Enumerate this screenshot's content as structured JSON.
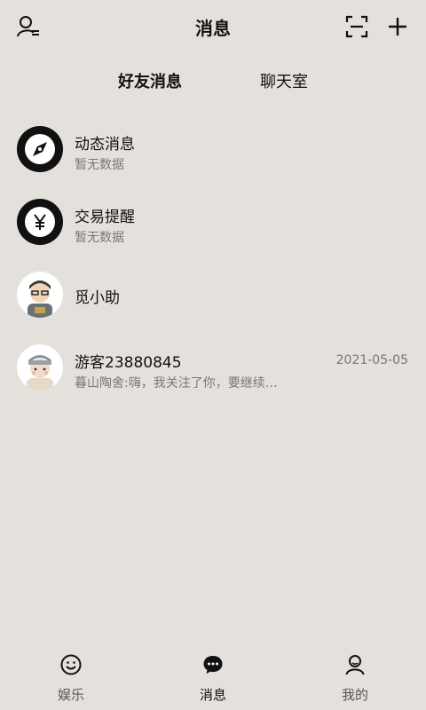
{
  "header": {
    "title": "消息"
  },
  "tabs": [
    {
      "label": "好友消息",
      "active": true
    },
    {
      "label": "聊天室",
      "active": false
    }
  ],
  "messages": [
    {
      "name": "动态消息",
      "preview": "暂无数据",
      "date": "",
      "icon": "compass-icon"
    },
    {
      "name": "交易提醒",
      "preview": "暂无数据",
      "date": "",
      "icon": "yen-icon"
    },
    {
      "name": "觅小助",
      "preview": "",
      "date": "",
      "icon": "assistant-avatar"
    },
    {
      "name": "游客23880845",
      "preview": "暮山陶舍:嗨，我关注了你，要继续…",
      "date": "2021-05-05",
      "icon": "guest-avatar"
    }
  ],
  "bottom_nav": [
    {
      "label": "娱乐",
      "icon": "smile-icon",
      "active": false
    },
    {
      "label": "消息",
      "icon": "chat-bubble-icon",
      "active": true
    },
    {
      "label": "我的",
      "icon": "person-icon",
      "active": false
    }
  ],
  "colors": {
    "background": "#e4e1dc",
    "accent": "#111111",
    "muted": "#777777"
  }
}
